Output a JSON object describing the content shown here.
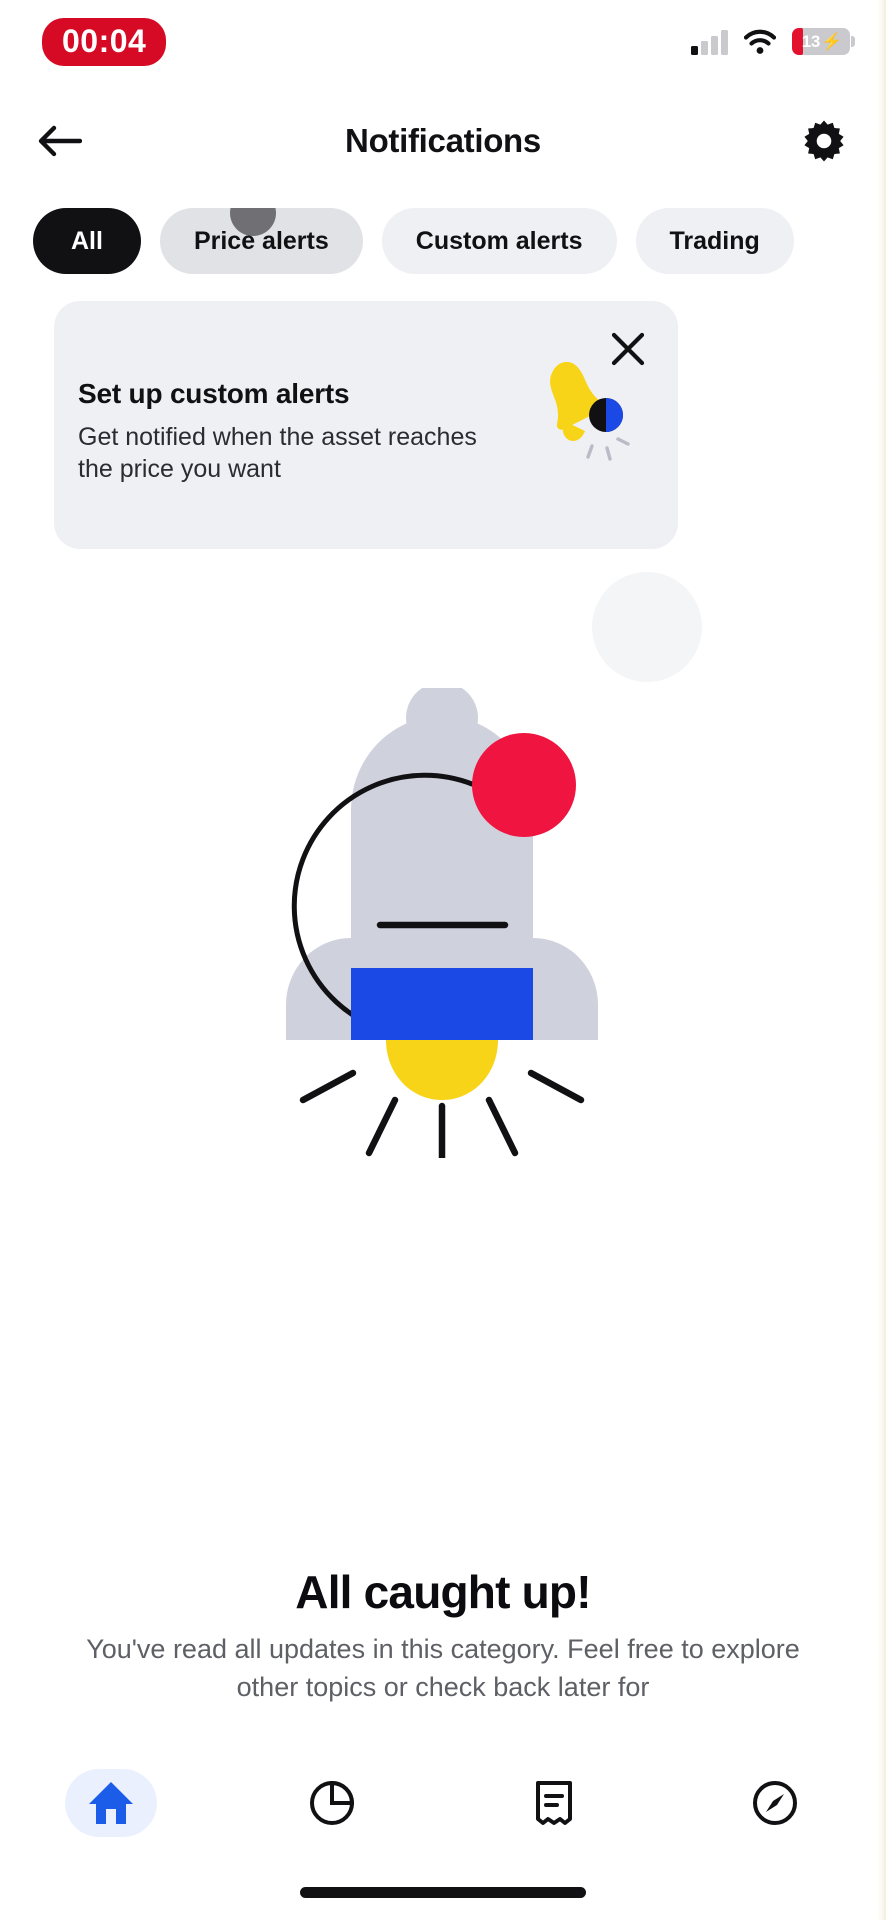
{
  "status_bar": {
    "time": "00:04",
    "signal_icon": "cellular-signal-icon",
    "signal_bars_total": 4,
    "signal_bars_active": 1,
    "wifi_icon": "wifi-icon",
    "battery_level": "13",
    "battery_charging_glyph": "⚡",
    "battery_color": "#e3112e",
    "time_pill_color": "#d60a24"
  },
  "header": {
    "back_icon": "arrow-left-icon",
    "title": "Notifications",
    "settings_icon": "gear-icon"
  },
  "tabs": [
    {
      "label": "All",
      "state": "active"
    },
    {
      "label": "Price alerts",
      "state": "pressed"
    },
    {
      "label": "Custom alerts",
      "state": "default"
    },
    {
      "label": "Trading",
      "state": "default"
    }
  ],
  "banner": {
    "title": "Set up custom alerts",
    "subtitle": "Get notified when the asset reaches the price you want",
    "close_icon": "close-icon",
    "illustration_icon": "bell-illustration-icon",
    "background": "#eff0f3"
  },
  "empty_state": {
    "illustration_icon": "rocket-illustration-icon",
    "title": "All caught up!",
    "description": "You've read all updates in this category. Feel free to explore other topics or check back later for",
    "rocket_colors": {
      "body": "#cfd2dc",
      "band": "#1b49e5",
      "badge_red": "#f01440",
      "badge_black": "#111114",
      "flame": "#f7d417"
    }
  },
  "bottom_nav": [
    {
      "icon": "home-icon",
      "state": "active",
      "color": "#1b5ce8"
    },
    {
      "icon": "pie-chart-icon",
      "state": "default",
      "color": "#111114"
    },
    {
      "icon": "receipt-icon",
      "state": "default",
      "color": "#111114"
    },
    {
      "icon": "compass-icon",
      "state": "default",
      "color": "#111114"
    }
  ],
  "home_indicator": "home-indicator"
}
